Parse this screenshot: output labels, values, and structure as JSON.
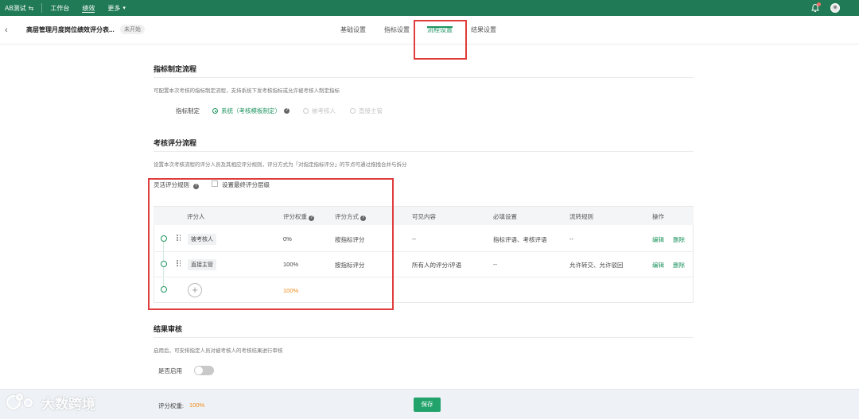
{
  "topnav": {
    "brand": "AB测试",
    "brand_switch": "⇆",
    "items": [
      {
        "label": "工作台",
        "active": false
      },
      {
        "label": "绩效",
        "active": true
      },
      {
        "label": "更多",
        "active": false
      }
    ],
    "more_caret": "▾"
  },
  "header": {
    "title": "高层管理月度岗位绩效评分表...",
    "status": "未开始",
    "tabs": [
      {
        "label": "基础设置",
        "active": false
      },
      {
        "label": "指标设置",
        "active": false
      },
      {
        "label": "流程设置",
        "active": true
      },
      {
        "label": "结果设置",
        "active": false
      }
    ]
  },
  "indicator": {
    "title": "指标制定流程",
    "desc": "可配置本次考核的指标制定流程，支持系统下发考核指标或允许被考核人制定指标",
    "label": "指标制定",
    "options": [
      {
        "label": "系统（考核模板制定）",
        "selected": true
      },
      {
        "label": "被考核人",
        "selected": false
      },
      {
        "label": "直接主管",
        "selected": false
      }
    ]
  },
  "review": {
    "title": "考核评分流程",
    "desc": "设置本次考核流程的评分人员及其相应评分规则，评分方式为「对指定指标评分」的节点可通过拖拽合并与拆分",
    "flex_rule_label": "灵活评分规则",
    "final_level_label": "设置最终评分层级",
    "columns": [
      "评分人",
      "评分权重",
      "评分方式",
      "可见内容",
      "必填设置",
      "流转规则",
      "操作"
    ],
    "rows": [
      {
        "rater": "被考核人",
        "weight": "0%",
        "method": "按指标评分",
        "visible": "--",
        "required": "指标评语、考核评语",
        "flow": "--",
        "edit": "编辑",
        "delete": "删除"
      },
      {
        "rater": "直接主管",
        "weight": "100%",
        "method": "按指标评分",
        "visible": "所有人的评分/评语",
        "required": "--",
        "flow": "允许转交、允许驳回",
        "edit": "编辑",
        "delete": "删除"
      }
    ],
    "total_weight": "100%",
    "add_symbol": "+"
  },
  "result": {
    "title": "结果审核",
    "desc": "启用后，可安排指定人员对被考核人的考核结果进行审核",
    "enable_label": "是否启用",
    "enabled": false
  },
  "footer": {
    "weight_label": "评分权重:",
    "weight_value": "100%",
    "save_label": "保存"
  },
  "watermark": {
    "text": "大数跨境"
  },
  "colors": {
    "nav": "#1f7a55",
    "accent": "#1f9460",
    "highlight": "#e03c3c",
    "orange": "#f08c1a"
  }
}
